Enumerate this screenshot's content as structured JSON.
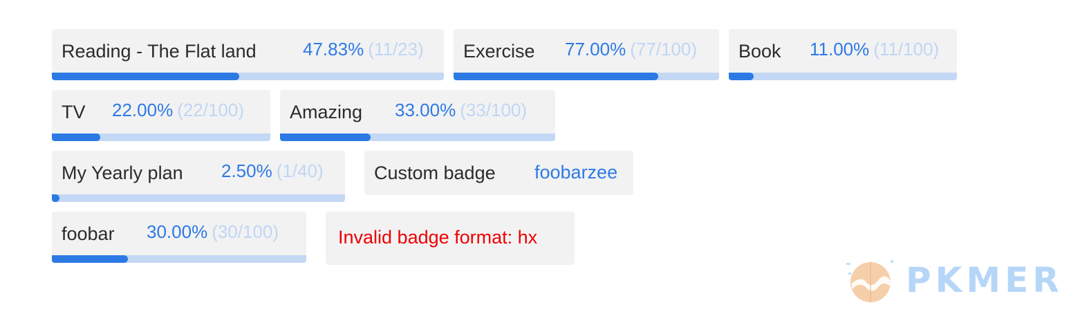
{
  "badges": [
    {
      "label": "Reading - The Flat land",
      "percent": "47.83%",
      "fraction": "(11/23)",
      "progress": 0.4783
    },
    {
      "label": "Exercise",
      "percent": "77.00%",
      "fraction": "(77/100)",
      "progress": 0.77
    },
    {
      "label": "Book",
      "percent": "11.00%",
      "fraction": "(11/100)",
      "progress": 0.11
    },
    {
      "label": "TV",
      "percent": "22.00%",
      "fraction": "(22/100)",
      "progress": 0.22
    },
    {
      "label": "Amazing",
      "percent": "33.00%",
      "fraction": "(33/100)",
      "progress": 0.33
    },
    {
      "label": "My Yearly plan",
      "percent": "2.50%",
      "fraction": "(1/40)",
      "progress": 0.025
    },
    {
      "label": "foobar",
      "percent": "30.00%",
      "fraction": "(30/100)",
      "progress": 0.3
    }
  ],
  "custom_badge": {
    "label": "Custom badge",
    "value": "foobarzee"
  },
  "invalid_badge": {
    "message": "Invalid badge format: hx"
  },
  "watermark": {
    "text": "PKMER",
    "icon": "pkmer-logo-icon"
  },
  "colors": {
    "accent": "#2d7ae5",
    "track": "#c3d8f5",
    "fraction": "#c0d6f4",
    "error": "#ee0000",
    "badge_bg": "#f2f2f3"
  }
}
